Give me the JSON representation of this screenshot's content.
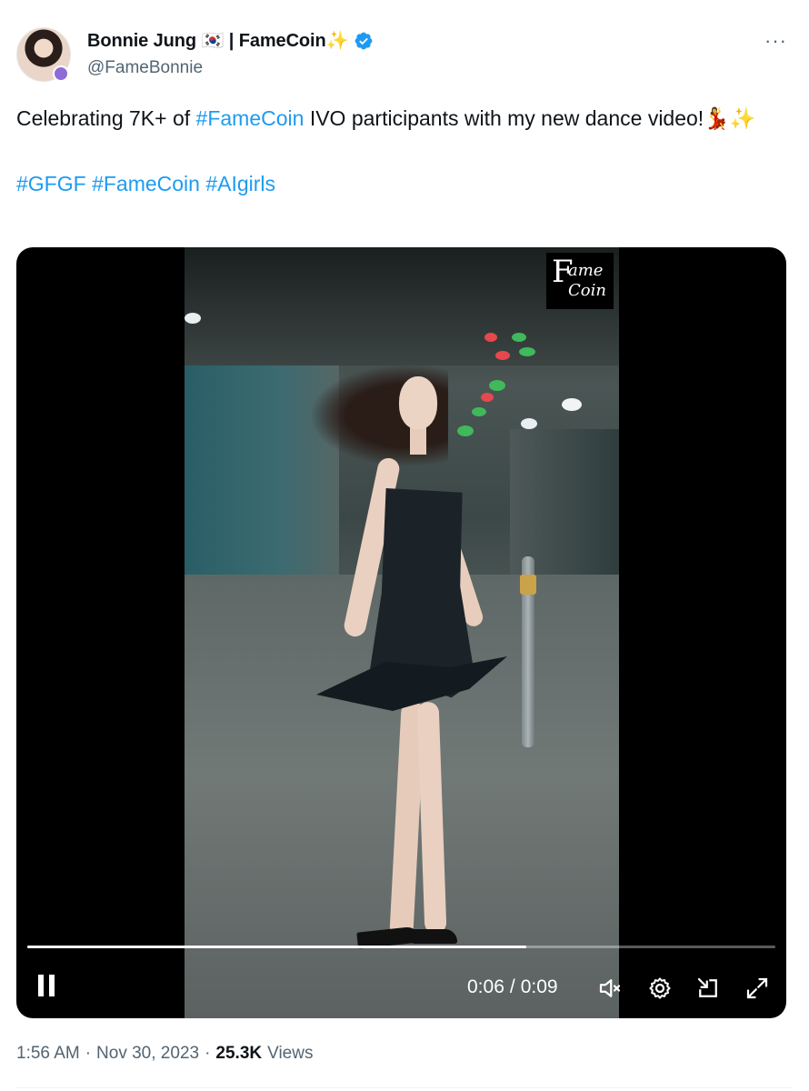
{
  "author": {
    "display_name": "Bonnie Jung",
    "flag": "🇰🇷",
    "separator": "|",
    "brand": "FameCoin",
    "sparkle": "✨",
    "handle": "@FameBonnie",
    "verified": true,
    "avatar_icon": "profile-photo"
  },
  "more_label": "···",
  "tweet": {
    "line1_before": "Celebrating 7K+ of ",
    "line1_tag": "#FameCoin",
    "line1_after": " IVO participants with my new dance video!",
    "line1_emoji": "💃✨",
    "hashtags": [
      "#GFGF",
      "#FameCoin",
      "#AIgirls"
    ]
  },
  "video": {
    "watermark_big": "F",
    "watermark_line1": "ame",
    "watermark_line2": "Coin",
    "progress": 0.667,
    "current_time": "0:06",
    "time_separator": "/",
    "duration": "0:09",
    "controls": [
      "pause-icon",
      "mute-icon",
      "settings-icon",
      "picture-in-picture-icon",
      "fullscreen-icon"
    ]
  },
  "meta": {
    "time": "1:56 AM",
    "dot1": "·",
    "date": "Nov 30, 2023",
    "dot2": "·",
    "views_count": "25.3K",
    "views_label": "Views"
  },
  "colors": {
    "link": "#1d9bf0",
    "text": "#0f1419",
    "muted": "#536471",
    "verified": "#1d9bf0"
  }
}
